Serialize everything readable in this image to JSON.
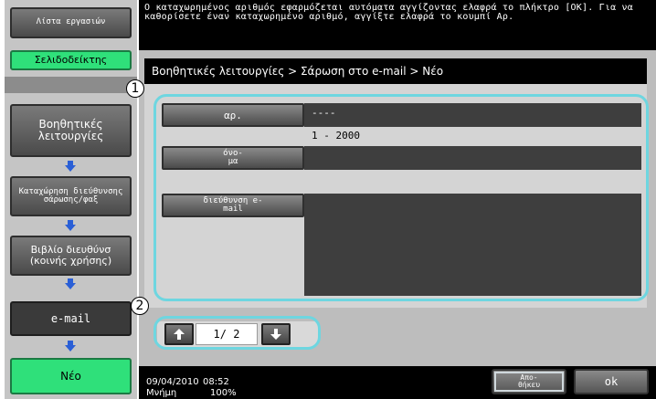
{
  "sidebar": {
    "task_list_label": "Λίστα εργασιών",
    "bookmark_label": "Σελιδοδείκτης",
    "steps": [
      {
        "label": "Βοηθητικές λειτουργίες"
      },
      {
        "label": "Καταχώρηση διεύθυνσης σάρωσης/φαξ"
      },
      {
        "label": "Βιβλίο διευθύνσ (κοινής χρήσης)"
      },
      {
        "label": "e-mail"
      },
      {
        "label": "Νέο"
      }
    ]
  },
  "message": "Ο καταχωρημένος αριθμός εφαρμόζεται αυτόματα αγγίζοντας ελαφρά το πλήκτρο [OK]. Για να καθορίσετε έναν καταχωρημένο αριθμό, αγγίξτε ελαφρά το κουμπί Αρ.",
  "breadcrumb": "Βοηθητικές λειτουργίες > Σάρωση στο e-mail > Νέο",
  "markers": {
    "one": "1",
    "two": "2"
  },
  "form": {
    "number_label": "αρ.",
    "number_value": "----",
    "number_range": "1 - 2000",
    "name_label": "όνο- μα",
    "name_value": "",
    "email_label": "διεύθυνση e-mail",
    "email_value": ""
  },
  "pager": {
    "text": "1/ 2"
  },
  "status": {
    "date": "09/04/2010",
    "time": "08:52",
    "memory_label": "Μνήμη",
    "memory_value": "100%"
  },
  "buttons": {
    "save_label": "Απο- θήκευ",
    "ok_label": "ok"
  },
  "colors": {
    "accent": "#6ed6e0",
    "green": "#2fe07a"
  },
  "icons": [
    "arrow-down-icon",
    "arrow-up-icon"
  ]
}
